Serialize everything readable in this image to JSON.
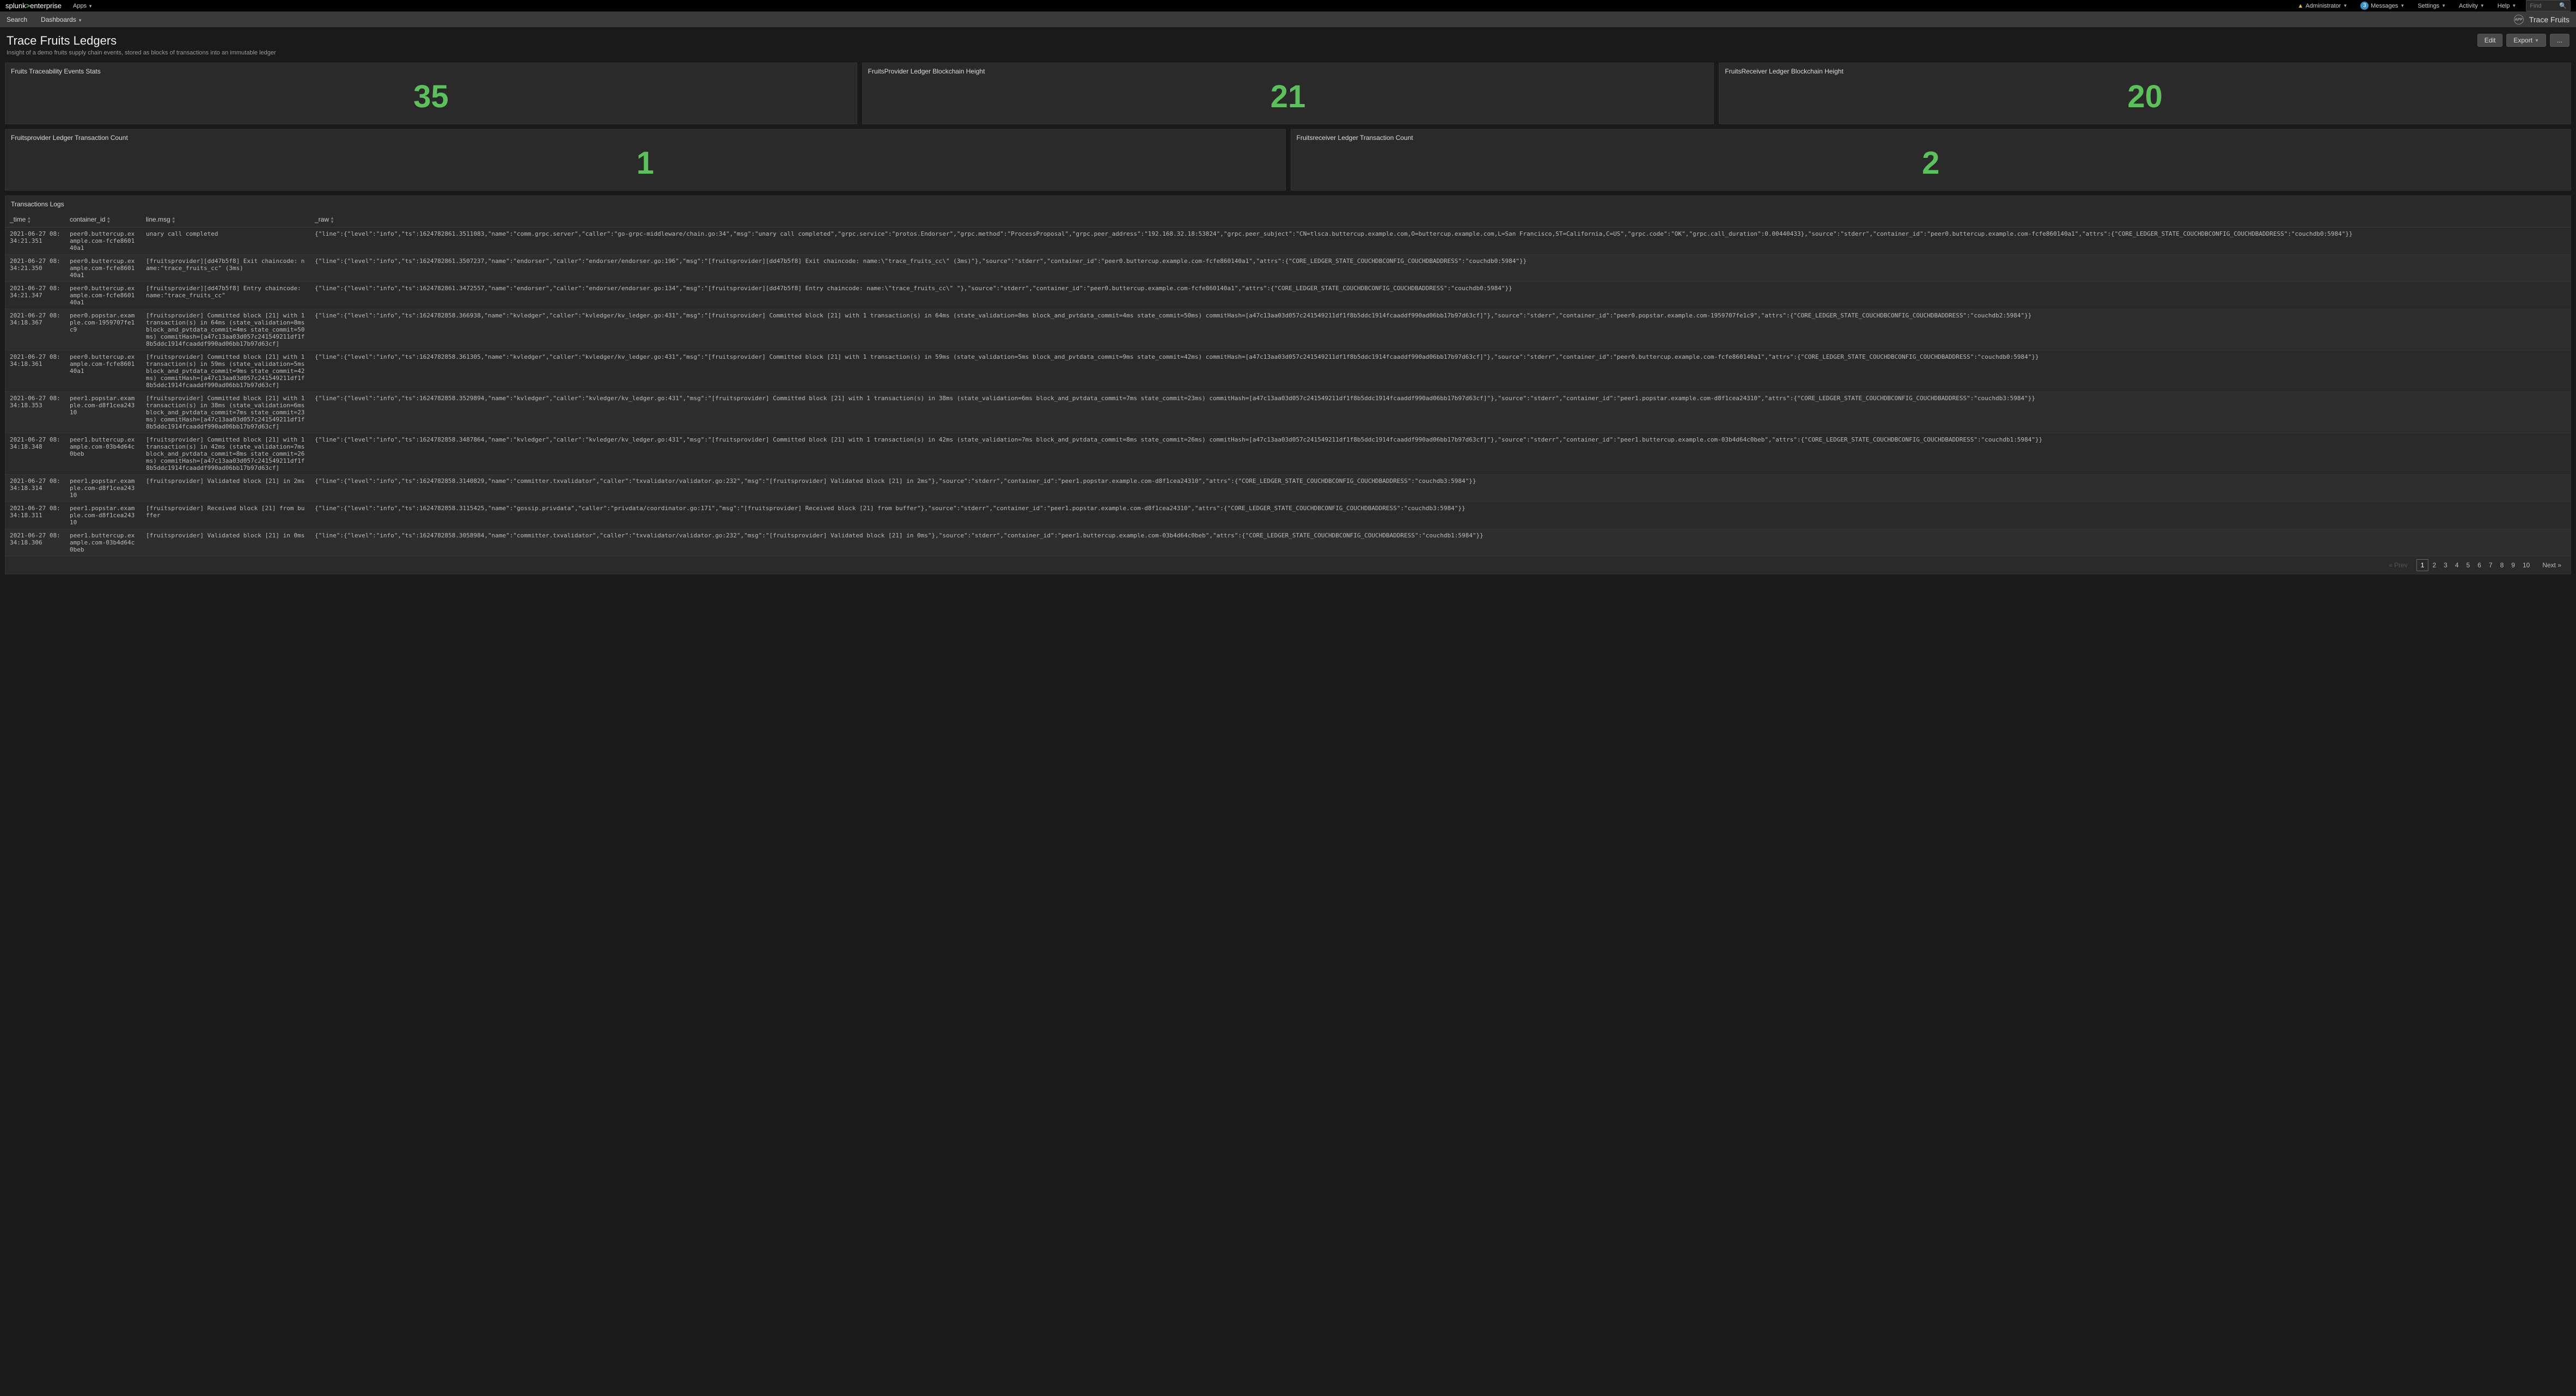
{
  "header": {
    "logo_left": "splunk",
    "logo_right": "enterprise",
    "apps": "Apps",
    "admin": "Administrator",
    "messages_count": "3",
    "messages": "Messages",
    "settings": "Settings",
    "activity": "Activity",
    "help": "Help",
    "find_placeholder": "Find"
  },
  "nav": {
    "search": "Search",
    "dashboards": "Dashboards",
    "app_name": "Trace Fruits",
    "app_badge": "APP"
  },
  "dashboard": {
    "title": "Trace Fruits Ledgers",
    "subtitle": "Insight of a demo fruits supply chain events, stored as blocks of transactions into an immutable ledger",
    "edit": "Edit",
    "export": "Export",
    "more": "..."
  },
  "stats": {
    "p1_title": "Fruits Traceability Events Stats",
    "p1_value": "35",
    "p2_title": "FruitsProvider Ledger Blockchain Height",
    "p2_value": "21",
    "p3_title": "FruitsReceiver Ledger Blockchain Height",
    "p3_value": "20",
    "p4_title": "Fruitsprovider Ledger Transaction Count",
    "p4_value": "1",
    "p5_title": "Fruitsreceiver Ledger Transaction Count",
    "p5_value": "2"
  },
  "table": {
    "title": "Transactions Logs",
    "h_time": "_time",
    "h_cid": "container_id",
    "h_msg": "line.msg",
    "h_raw": "_raw",
    "rows": [
      {
        "time": "2021-06-27 08:34:21.351",
        "cid": "peer0.buttercup.example.com-fcfe860140a1",
        "msg": "unary call completed",
        "raw": "{\"line\":{\"level\":\"info\",\"ts\":1624782861.3511083,\"name\":\"comm.grpc.server\",\"caller\":\"go-grpc-middleware/chain.go:34\",\"msg\":\"unary call completed\",\"grpc.service\":\"protos.Endorser\",\"grpc.method\":\"ProcessProposal\",\"grpc.peer_address\":\"192.168.32.18:53824\",\"grpc.peer_subject\":\"CN=tlsca.buttercup.example.com,O=buttercup.example.com,L=San Francisco,ST=California,C=US\",\"grpc.code\":\"OK\",\"grpc.call_duration\":0.00440433},\"source\":\"stderr\",\"container_id\":\"peer0.buttercup.example.com-fcfe860140a1\",\"attrs\":{\"CORE_LEDGER_STATE_COUCHDBCONFIG_COUCHDBADDRESS\":\"couchdb0:5984\"}}"
      },
      {
        "time": "2021-06-27 08:34:21.350",
        "cid": "peer0.buttercup.example.com-fcfe860140a1",
        "msg": "[fruitsprovider][dd47b5f8] Exit chaincode: name:\"trace_fruits_cc\" (3ms)",
        "raw": "{\"line\":{\"level\":\"info\",\"ts\":1624782861.3507237,\"name\":\"endorser\",\"caller\":\"endorser/endorser.go:196\",\"msg\":\"[fruitsprovider][dd47b5f8] Exit chaincode: name:\\\"trace_fruits_cc\\\" (3ms)\"},\"source\":\"stderr\",\"container_id\":\"peer0.buttercup.example.com-fcfe860140a1\",\"attrs\":{\"CORE_LEDGER_STATE_COUCHDBCONFIG_COUCHDBADDRESS\":\"couchdb0:5984\"}}"
      },
      {
        "time": "2021-06-27 08:34:21.347",
        "cid": "peer0.buttercup.example.com-fcfe860140a1",
        "msg": "[fruitsprovider][dd47b5f8] Entry chaincode: name:\"trace_fruits_cc\"",
        "raw": "{\"line\":{\"level\":\"info\",\"ts\":1624782861.3472557,\"name\":\"endorser\",\"caller\":\"endorser/endorser.go:134\",\"msg\":\"[fruitsprovider][dd47b5f8] Entry chaincode: name:\\\"trace_fruits_cc\\\" \"},\"source\":\"stderr\",\"container_id\":\"peer0.buttercup.example.com-fcfe860140a1\",\"attrs\":{\"CORE_LEDGER_STATE_COUCHDBCONFIG_COUCHDBADDRESS\":\"couchdb0:5984\"}}"
      },
      {
        "time": "2021-06-27 08:34:18.367",
        "cid": "peer0.popstar.example.com-1959707fe1c9",
        "msg": "[fruitsprovider] Committed block [21] with 1 transaction(s) in 64ms (state_validation=8ms block_and_pvtdata_commit=4ms state_commit=50ms) commitHash=[a47c13aa03d057c241549211df1f8b5ddc1914fcaaddf990ad06bb17b97d63cf]",
        "raw": "{\"line\":{\"level\":\"info\",\"ts\":1624782858.366938,\"name\":\"kvledger\",\"caller\":\"kvledger/kv_ledger.go:431\",\"msg\":\"[fruitsprovider] Committed block [21] with 1 transaction(s) in 64ms (state_validation=8ms block_and_pvtdata_commit=4ms state_commit=50ms) commitHash=[a47c13aa03d057c241549211df1f8b5ddc1914fcaaddf990ad06bb17b97d63cf]\"},\"source\":\"stderr\",\"container_id\":\"peer0.popstar.example.com-1959707fe1c9\",\"attrs\":{\"CORE_LEDGER_STATE_COUCHDBCONFIG_COUCHDBADDRESS\":\"couchdb2:5984\"}}"
      },
      {
        "time": "2021-06-27 08:34:18.361",
        "cid": "peer0.buttercup.example.com-fcfe860140a1",
        "msg": "[fruitsprovider] Committed block [21] with 1 transaction(s) in 59ms (state_validation=5ms block_and_pvtdata_commit=9ms state_commit=42ms) commitHash=[a47c13aa03d057c241549211df1f8b5ddc1914fcaaddf990ad06bb17b97d63cf]",
        "raw": "{\"line\":{\"level\":\"info\",\"ts\":1624782858.361305,\"name\":\"kvledger\",\"caller\":\"kvledger/kv_ledger.go:431\",\"msg\":\"[fruitsprovider] Committed block [21] with 1 transaction(s) in 59ms (state_validation=5ms block_and_pvtdata_commit=9ms state_commit=42ms) commitHash=[a47c13aa03d057c241549211df1f8b5ddc1914fcaaddf990ad06bb17b97d63cf]\"},\"source\":\"stderr\",\"container_id\":\"peer0.buttercup.example.com-fcfe860140a1\",\"attrs\":{\"CORE_LEDGER_STATE_COUCHDBCONFIG_COUCHDBADDRESS\":\"couchdb0:5984\"}}"
      },
      {
        "time": "2021-06-27 08:34:18.353",
        "cid": "peer1.popstar.example.com-d8f1cea24310",
        "msg": "[fruitsprovider] Committed block [21] with 1 transaction(s) in 38ms (state_validation=6ms block_and_pvtdata_commit=7ms state_commit=23ms) commitHash=[a47c13aa03d057c241549211df1f8b5ddc1914fcaaddf990ad06bb17b97d63cf]",
        "raw": "{\"line\":{\"level\":\"info\",\"ts\":1624782858.3529894,\"name\":\"kvledger\",\"caller\":\"kvledger/kv_ledger.go:431\",\"msg\":\"[fruitsprovider] Committed block [21] with 1 transaction(s) in 38ms (state_validation=6ms block_and_pvtdata_commit=7ms state_commit=23ms) commitHash=[a47c13aa03d057c241549211df1f8b5ddc1914fcaaddf990ad06bb17b97d63cf]\"},\"source\":\"stderr\",\"container_id\":\"peer1.popstar.example.com-d8f1cea24310\",\"attrs\":{\"CORE_LEDGER_STATE_COUCHDBCONFIG_COUCHDBADDRESS\":\"couchdb3:5984\"}}"
      },
      {
        "time": "2021-06-27 08:34:18.348",
        "cid": "peer1.buttercup.example.com-03b4d64c0beb",
        "msg": "[fruitsprovider] Committed block [21] with 1 transaction(s) in 42ms (state_validation=7ms block_and_pvtdata_commit=8ms state_commit=26ms) commitHash=[a47c13aa03d057c241549211df1f8b5ddc1914fcaaddf990ad06bb17b97d63cf]",
        "raw": "{\"line\":{\"level\":\"info\",\"ts\":1624782858.3487864,\"name\":\"kvledger\",\"caller\":\"kvledger/kv_ledger.go:431\",\"msg\":\"[fruitsprovider] Committed block [21] with 1 transaction(s) in 42ms (state_validation=7ms block_and_pvtdata_commit=8ms state_commit=26ms) commitHash=[a47c13aa03d057c241549211df1f8b5ddc1914fcaaddf990ad06bb17b97d63cf]\"},\"source\":\"stderr\",\"container_id\":\"peer1.buttercup.example.com-03b4d64c0beb\",\"attrs\":{\"CORE_LEDGER_STATE_COUCHDBCONFIG_COUCHDBADDRESS\":\"couchdb1:5984\"}}"
      },
      {
        "time": "2021-06-27 08:34:18.314",
        "cid": "peer1.popstar.example.com-d8f1cea24310",
        "msg": "[fruitsprovider] Validated block [21] in 2ms",
        "raw": "{\"line\":{\"level\":\"info\",\"ts\":1624782858.3140829,\"name\":\"committer.txvalidator\",\"caller\":\"txvalidator/validator.go:232\",\"msg\":\"[fruitsprovider] Validated block [21] in 2ms\"},\"source\":\"stderr\",\"container_id\":\"peer1.popstar.example.com-d8f1cea24310\",\"attrs\":{\"CORE_LEDGER_STATE_COUCHDBCONFIG_COUCHDBADDRESS\":\"couchdb3:5984\"}}"
      },
      {
        "time": "2021-06-27 08:34:18.311",
        "cid": "peer1.popstar.example.com-d8f1cea24310",
        "msg": "[fruitsprovider] Received block [21] from buffer",
        "raw": "{\"line\":{\"level\":\"info\",\"ts\":1624782858.3115425,\"name\":\"gossip.privdata\",\"caller\":\"privdata/coordinator.go:171\",\"msg\":\"[fruitsprovider] Received block [21] from buffer\"},\"source\":\"stderr\",\"container_id\":\"peer1.popstar.example.com-d8f1cea24310\",\"attrs\":{\"CORE_LEDGER_STATE_COUCHDBCONFIG_COUCHDBADDRESS\":\"couchdb3:5984\"}}"
      },
      {
        "time": "2021-06-27 08:34:18.306",
        "cid": "peer1.buttercup.example.com-03b4d64c0beb",
        "msg": "[fruitsprovider] Validated block [21] in 0ms",
        "raw": "{\"line\":{\"level\":\"info\",\"ts\":1624782858.3058984,\"name\":\"committer.txvalidator\",\"caller\":\"txvalidator/validator.go:232\",\"msg\":\"[fruitsprovider] Validated block [21] in 0ms\"},\"source\":\"stderr\",\"container_id\":\"peer1.buttercup.example.com-03b4d64c0beb\",\"attrs\":{\"CORE_LEDGER_STATE_COUCHDBCONFIG_COUCHDBADDRESS\":\"couchdb1:5984\"}}"
      }
    ]
  },
  "pagination": {
    "prev": "« Prev",
    "pages": [
      "1",
      "2",
      "3",
      "4",
      "5",
      "6",
      "7",
      "8",
      "9",
      "10"
    ],
    "next": "Next »"
  }
}
